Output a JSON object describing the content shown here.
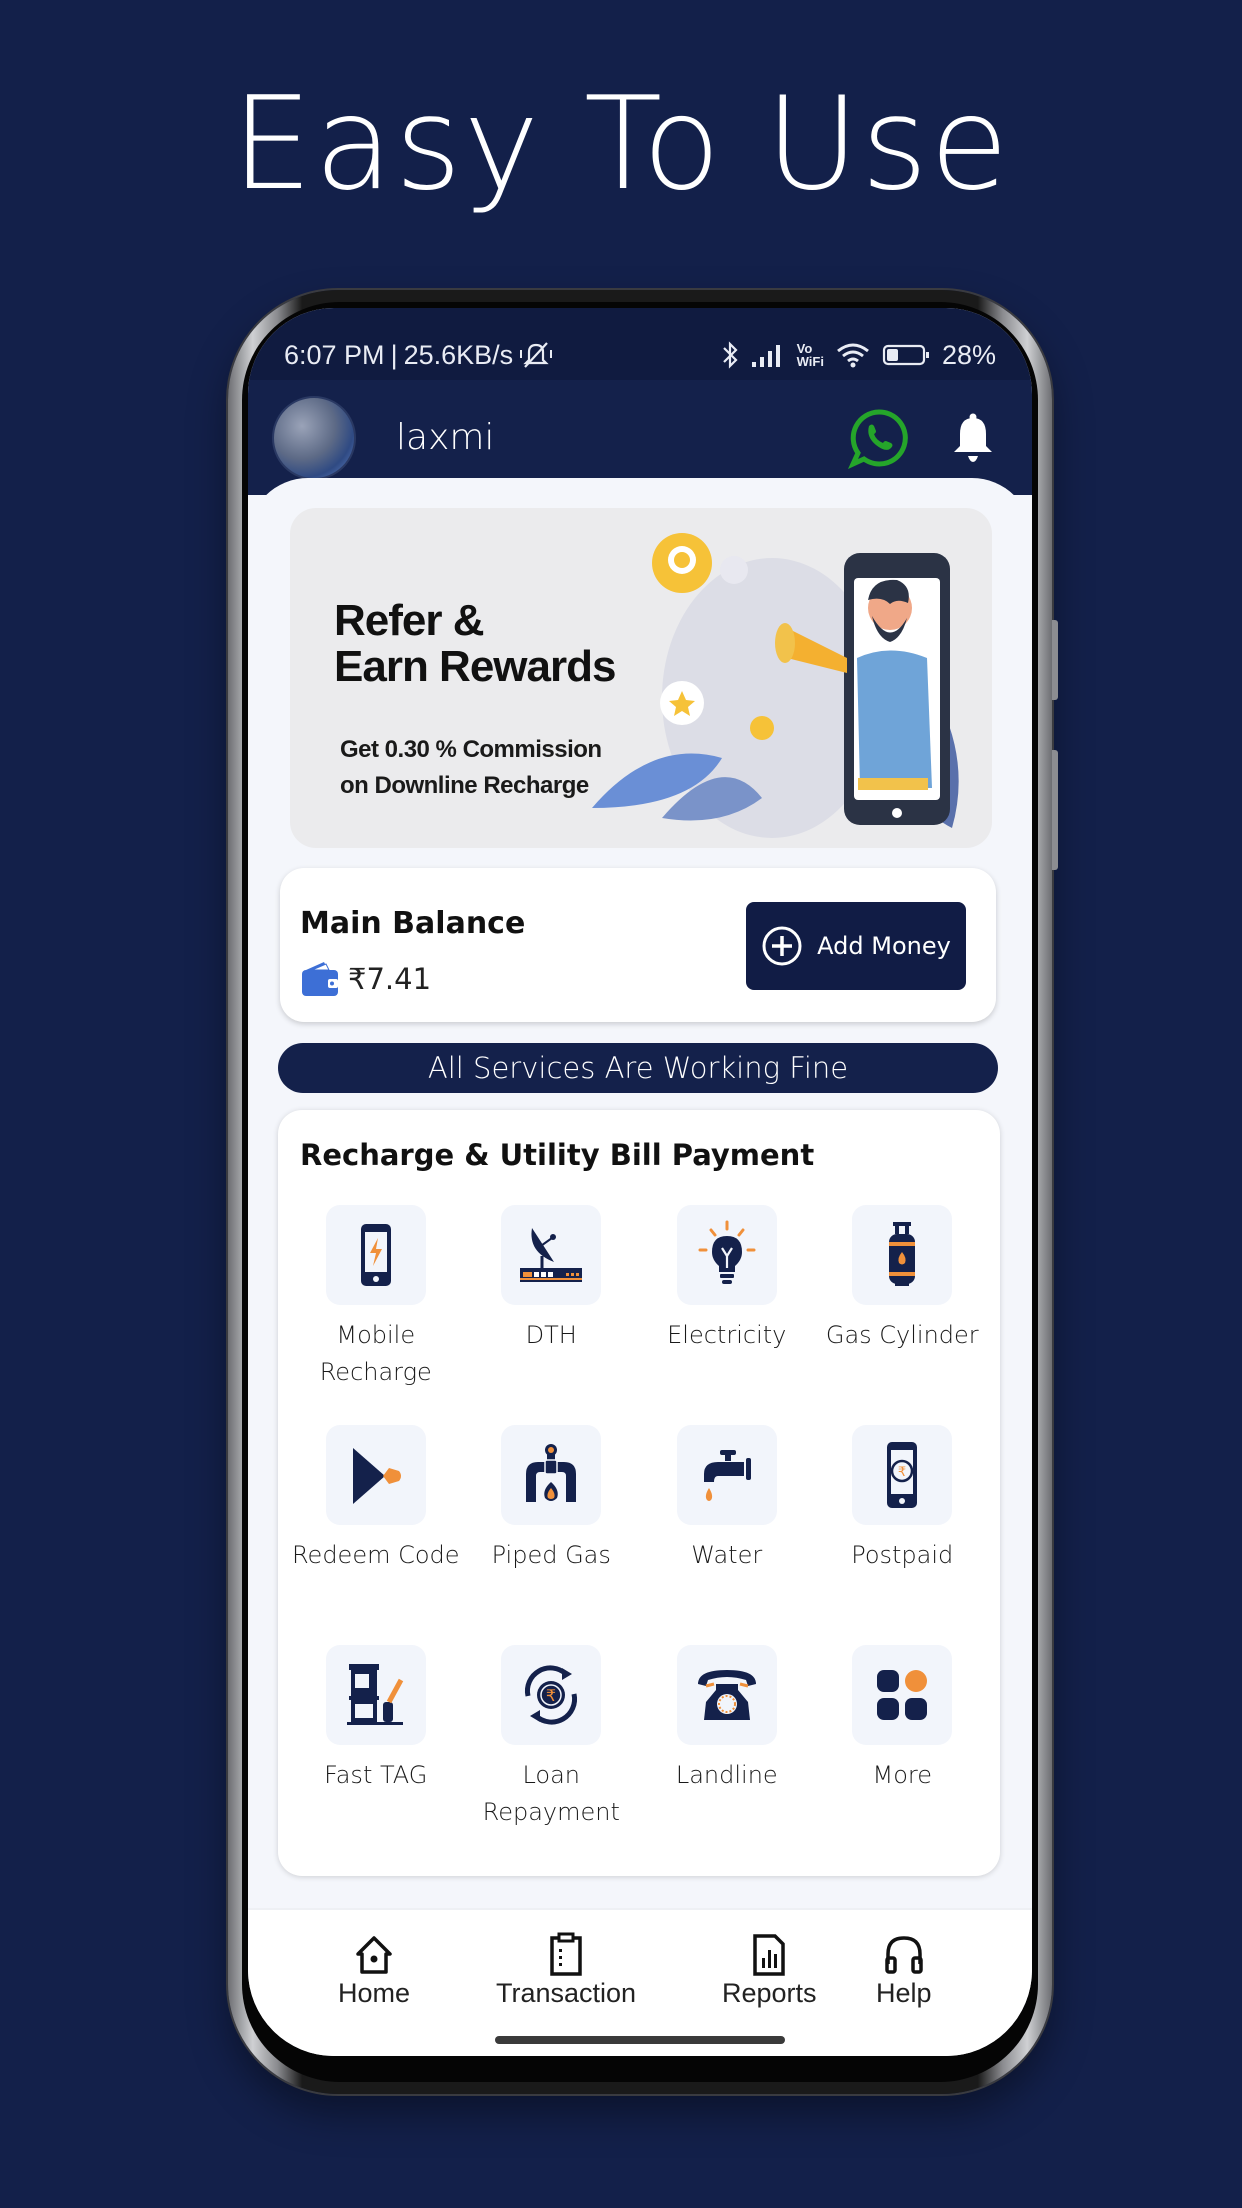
{
  "headline": "Easy To Use",
  "status_bar": {
    "time": "6:07 PM",
    "separator": "|",
    "network_speed": "25.6KB/s",
    "battery_percent": "28%",
    "icons": [
      "mute-icon",
      "bluetooth-icon",
      "signal-icon",
      "vowifi-icon",
      "wifi-icon",
      "battery-icon"
    ],
    "vowifi_top": "Vo",
    "vowifi_bottom": "WiFi"
  },
  "app_bar": {
    "username": "laxmi",
    "icons": [
      "avatar",
      "whatsapp-icon",
      "bell-icon"
    ]
  },
  "banner": {
    "title_line1": "Refer &",
    "title_line2": "Earn Rewards",
    "subtitle_line1": "Get 0.30 % Commission",
    "subtitle_line2": "on Downline Recharge"
  },
  "balance": {
    "label": "Main Balance",
    "amount": "₹7.41",
    "add_money_label": "Add Money"
  },
  "status_message": "All Services Are Working Fine",
  "services": {
    "title": "Recharge & Utility Bill Payment",
    "items": [
      {
        "label": "Mobile Recharge",
        "icon": "mobile-recharge-icon"
      },
      {
        "label": "DTH",
        "icon": "dth-icon"
      },
      {
        "label": "Electricity",
        "icon": "electricity-icon"
      },
      {
        "label": "Gas Cylinder",
        "icon": "gas-cylinder-icon"
      },
      {
        "label": "Redeem Code",
        "icon": "redeem-code-icon"
      },
      {
        "label": "Piped Gas",
        "icon": "piped-gas-icon"
      },
      {
        "label": "Water",
        "icon": "water-icon"
      },
      {
        "label": "Postpaid",
        "icon": "postpaid-icon"
      },
      {
        "label": "Fast TAG",
        "icon": "fastag-icon"
      },
      {
        "label": "Loan Repayment",
        "icon": "loan-repayment-icon"
      },
      {
        "label": "Landline",
        "icon": "landline-icon"
      },
      {
        "label": "More",
        "icon": "more-icon"
      }
    ]
  },
  "bottom_nav": [
    {
      "label": "Home",
      "icon": "home-icon"
    },
    {
      "label": "Transaction",
      "icon": "transaction-icon"
    },
    {
      "label": "Reports",
      "icon": "reports-icon"
    },
    {
      "label": "Help",
      "icon": "headset-icon"
    }
  ],
  "colors": {
    "background": "#13204a",
    "primary_navy": "#14214b",
    "accent_orange": "#f0903a",
    "whatsapp_green": "#25a52a",
    "wallet_blue": "#3d6fd6"
  }
}
